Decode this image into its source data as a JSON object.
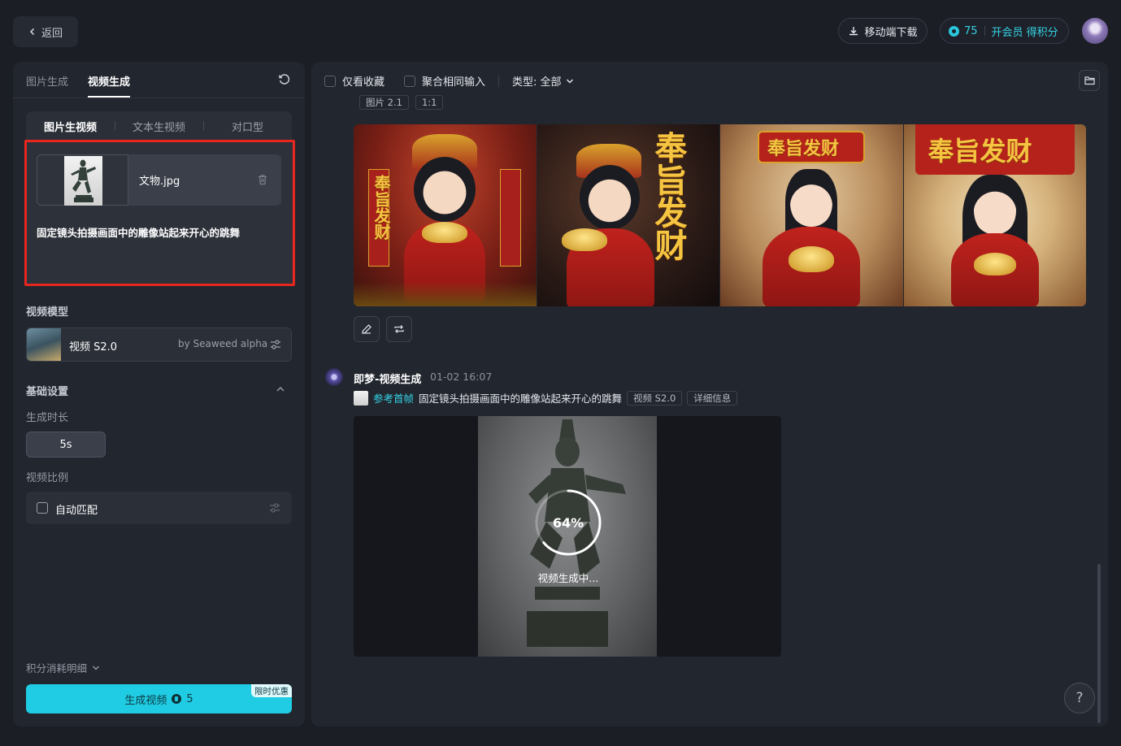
{
  "topbar": {
    "back_label": "返回",
    "download_label": "移动端下载",
    "credits": "75",
    "vip_label": "开会员 得积分"
  },
  "left": {
    "tabs": [
      {
        "label": "图片生成",
        "active": false
      },
      {
        "label": "视频生成",
        "active": true
      }
    ],
    "modes": [
      {
        "label": "图片生视频",
        "active": true
      },
      {
        "label": "文本生视频",
        "active": false
      },
      {
        "label": "对口型",
        "active": false
      }
    ],
    "upload": {
      "file_name": "文物.jpg",
      "prompt": "固定镜头拍摄画面中的雕像站起来开心的跳舞"
    },
    "model_section_label": "视频模型",
    "model": {
      "name": "视频 S2.0",
      "by": "by Seaweed alpha"
    },
    "basic_settings_label": "基础设置",
    "duration_label": "生成时长",
    "duration_value": "5s",
    "ratio_label": "视频比例",
    "ratio_value": "自动匹配",
    "cost_detail_label": "积分消耗明细",
    "generate_label": "生成视频",
    "generate_cost": "5",
    "promo_badge": "限时优惠"
  },
  "right": {
    "filters": {
      "favorites_label": "仅看收藏",
      "merge_label": "聚合相同输入",
      "type_label": "类型: 全部"
    },
    "image_group": {
      "chips": [
        "图片 2.1",
        "1:1"
      ],
      "images": [
        {
          "caption": "奉旨发财"
        },
        {
          "caption": "奉旨发财"
        },
        {
          "caption": "奉旨发财"
        },
        {
          "caption": "奉旨发财"
        }
      ]
    },
    "video_msg": {
      "title": "即梦-视频生成",
      "time": "01-02  16:07",
      "ref_label": "参考首帧",
      "prompt": "固定镜头拍摄画面中的雕像站起来开心的跳舞",
      "model_chip": "视频 S2.0",
      "detail_chip": "详细信息",
      "progress_percent": 64,
      "progress_text": "64%",
      "status_text": "视频生成中..."
    },
    "help_label": "?"
  }
}
